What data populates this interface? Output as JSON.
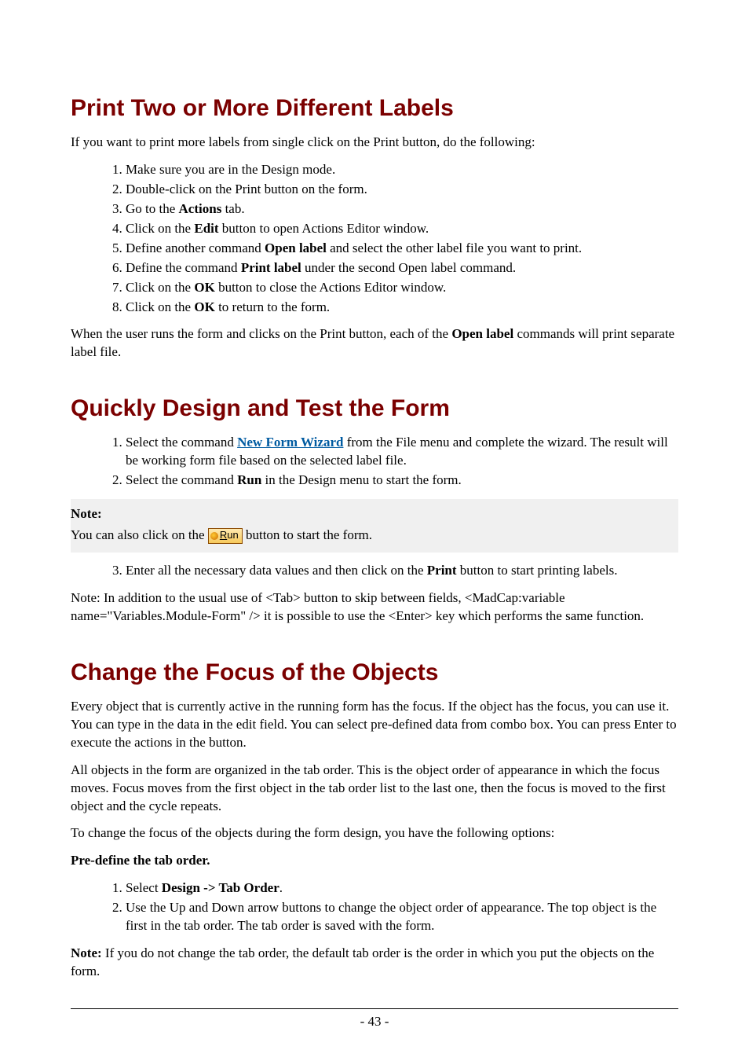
{
  "section1": {
    "heading": "Print Two or More Different Labels",
    "intro": "If you want to print more labels from single click on the Print button, do the following:",
    "steps": {
      "s1": "Make sure you are in the Design mode.",
      "s2": "Double-click on the Print button on the form.",
      "s3a": "Go to the ",
      "s3b": "Actions",
      "s3c": " tab.",
      "s4a": "Click on the ",
      "s4b": "Edit",
      "s4c": " button to open Actions Editor window.",
      "s5a": "Define another command ",
      "s5b": "Open label",
      "s5c": " and select the other label file you want to print.",
      "s6a": "Define the command ",
      "s6b": "Print label",
      "s6c": " under the second Open label command.",
      "s7a": "Click on the ",
      "s7b": "OK",
      "s7c": " button to close the Actions Editor window.",
      "s8a": "Click on the ",
      "s8b": "OK",
      "s8c": " to return to the form."
    },
    "outro_a": "When the user runs the form and clicks on the Print button, each of the ",
    "outro_b": "Open label",
    "outro_c": " commands will print separate label file."
  },
  "section2": {
    "heading": "Quickly Design and Test the Form",
    "s1a": "Select the command ",
    "s1_link": "New Form Wizard",
    "s1b": " from the File menu and complete the wizard. The result will be working form file based on the selected label file.",
    "s2a": "Select the command ",
    "s2b": "Run",
    "s2c": " in the Design menu to start the form.",
    "note_title": "Note:",
    "note_a": "You can also click on the ",
    "run_letter": "R",
    "run_rest": "un",
    "note_b": " button to start the form.",
    "s3a": "Enter all the necessary data values and then click on the ",
    "s3b": "Print",
    "s3c": " button to start printing labels.",
    "footnote": "Note: In addition to the usual use of <Tab> button to skip between fields, <MadCap:variable name=\"Variables.Module-Form\" /> it is possible to use the <Enter> key which performs the same function."
  },
  "section3": {
    "heading": "Change the Focus of the Objects",
    "p1": "Every object that is currently active in the running form has the focus. If the object has the focus, you can use it. You can type in the data in the edit field. You can select pre-defined data from combo box. You can press Enter to execute the actions in the button.",
    "p2": "All objects in the form are organized in the tab order. This is the object order of appearance in which the focus moves. Focus moves from the first object in the tab order list to the last one, then the focus is moved to the first object and the cycle repeats.",
    "p3": "To change the focus of the objects during the form design, you have the following options:",
    "sub_heading": "Pre-define the tab order.",
    "s1a": "Select ",
    "s1b": "Design -> Tab Order",
    "s1c": ".",
    "s2": "Use the Up and Down arrow buttons to change the object order of appearance. The top object is the first in the tab order. The tab order is saved with the form.",
    "note_a": "Note:",
    "note_b": " If you do not change the tab order, the default tab order is the order in which you put the objects on the form."
  },
  "page_number": "- 43 -"
}
